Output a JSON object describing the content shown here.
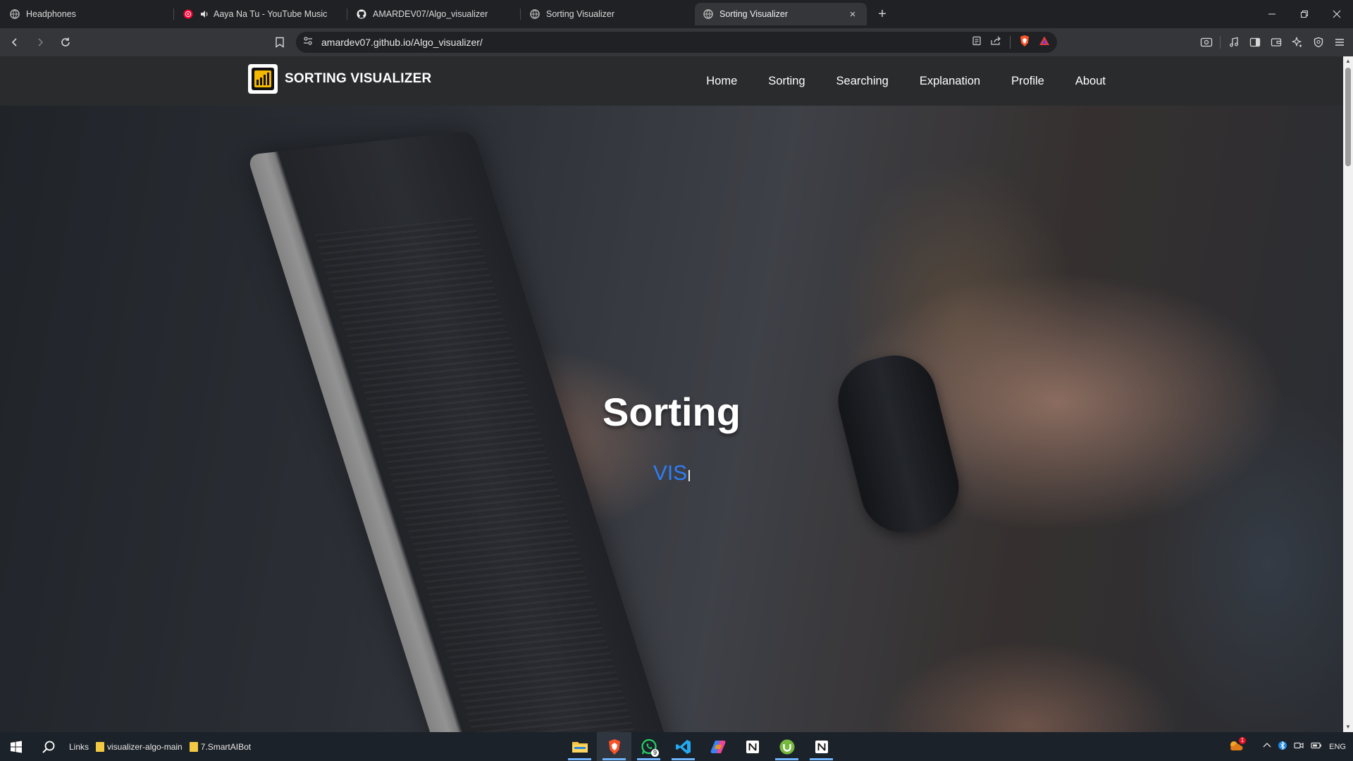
{
  "browser": {
    "tabs": [
      {
        "title": "Headphones",
        "icon": "globe-icon",
        "active": false
      },
      {
        "title": "Aaya Na Tu - YouTube Music",
        "icon": "youtube-music-icon",
        "audio": true,
        "active": false
      },
      {
        "title": "AMARDEV07/Algo_visualizer",
        "icon": "github-icon",
        "active": false
      },
      {
        "title": "Sorting Visualizer",
        "icon": "globe-icon",
        "active": false
      },
      {
        "title": "Sorting Visualizer",
        "icon": "globe-icon",
        "active": true,
        "close": "×"
      }
    ],
    "new_tab": "+",
    "window_controls": {
      "minimize": "—",
      "restore": "❐",
      "close": "✕"
    },
    "address": "amardev07.github.io/Algo_visualizer/"
  },
  "site": {
    "brand": "SORTING VISUALIZER",
    "menu": [
      "Home",
      "Sorting",
      "Searching",
      "Explanation",
      "Profile",
      "About"
    ],
    "hero_title": "Sorting",
    "hero_typed": "VIS",
    "accent": "#2e7df6"
  },
  "taskbar": {
    "links_label": "Links",
    "folders": [
      "visualizer-algo-main",
      "7.SmartAIBot"
    ],
    "apps": [
      "file-explorer-icon",
      "brave-icon",
      "whatsapp-icon",
      "vscode-icon",
      "copilot-icon",
      "notion-icon",
      "utorrent-icon",
      "notion-icon"
    ],
    "whatsapp_badge": "9",
    "tray_badge": "1",
    "lang": "ENG"
  }
}
